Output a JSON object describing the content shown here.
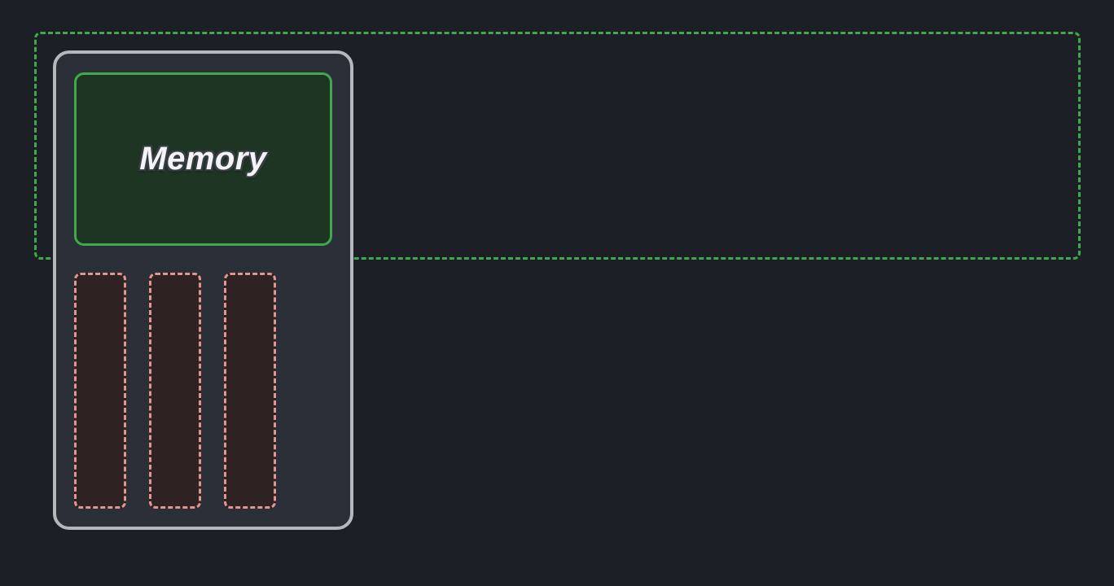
{
  "colors": {
    "background": "#1c1f25",
    "region_border": "#3fa94b",
    "card_bg": "#2b2f38",
    "card_border": "#b4b8bd",
    "memory_bg": "#1e3524",
    "memory_border": "#3fa94b",
    "slot_border": "#e19590",
    "slot_bg": "#2e2222",
    "label_text": "#f3f4f5"
  },
  "components": {
    "memory_label": "Memory",
    "slot_count": 3
  }
}
